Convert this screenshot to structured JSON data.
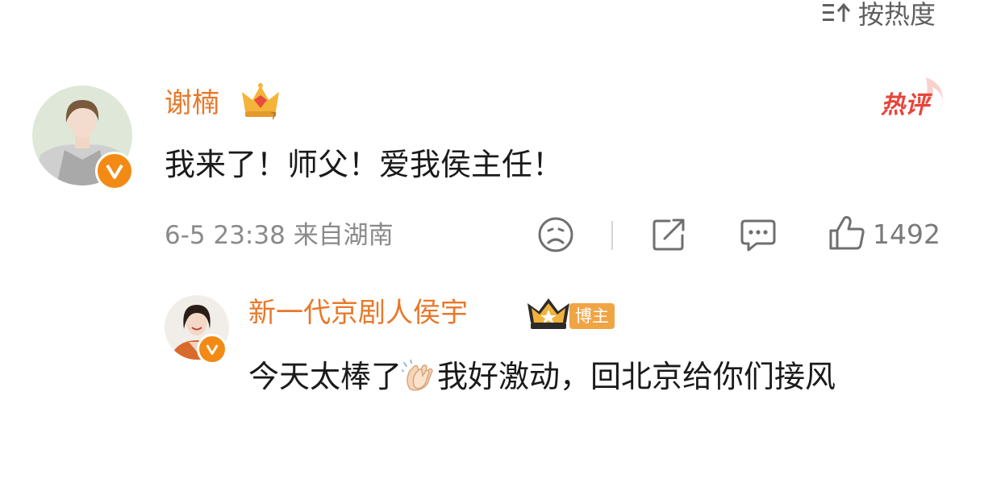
{
  "sort": {
    "label": "按热度",
    "icon": "sort-icon"
  },
  "comment": {
    "author": "谢楠",
    "text": "我来了！师父！爱我侯主任！",
    "tag": "热评",
    "timestamp": "6-5 23:38",
    "location": "来自湖南",
    "like_count": "1492",
    "colors": {
      "username": "#e8782a",
      "hot_tag": "#e8443a",
      "verified": "#f38a14"
    }
  },
  "reply": {
    "author": "新一代京剧人侯宇",
    "badge": "博主",
    "text_before": "今天太棒了",
    "emoji": "clapping-hands-icon",
    "text_after": "我好激动，回北京给你们接风"
  }
}
